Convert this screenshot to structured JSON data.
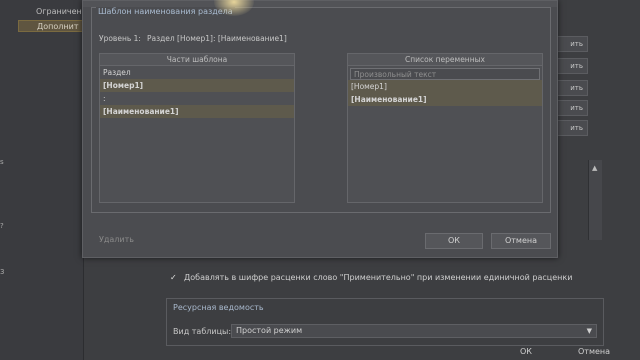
{
  "background": {
    "left_panel": {
      "items": [
        "Ограничен",
        "Дополнит"
      ],
      "selected_index": 1,
      "edge_glyphs": [
        "s",
        "?",
        "3"
      ]
    },
    "side_buttons": [
      "ить",
      "ить",
      "ить",
      "ить",
      "ить"
    ],
    "checkbox_row": {
      "checked": true,
      "label": "Добавлять в шифре расценки слово \"Применительно\" при изменении единичной расценки"
    },
    "resource_group": {
      "title": "Ресурсная ведомость",
      "view_label": "Вид таблицы:",
      "view_value": "Простой режим"
    },
    "footer": {
      "ok": "ОК",
      "cancel": "Отмена"
    }
  },
  "dialog": {
    "frame_title": "Шаблон наименования раздела",
    "level_label": "Уровень 1:",
    "level_value": "Раздел [Номер1]: [Наименование1]",
    "left_panel": {
      "header": "Части шаблона",
      "items": [
        {
          "text": "Раздел",
          "bold": false
        },
        {
          "text": "[Номер1]",
          "bold": true
        },
        {
          "text": ":",
          "bold": false
        },
        {
          "text": "[Наименование1]",
          "bold": true
        }
      ]
    },
    "right_panel": {
      "header": "Список переменных",
      "input_placeholder": "Произвольный текст",
      "items": [
        {
          "text": "[Номер1]",
          "bold": false
        },
        {
          "text": "[Наименование1]",
          "bold": true
        }
      ]
    },
    "move_left": "<<",
    "move_right": ">>",
    "delete_label": "Удалить",
    "ok_label": "ОК",
    "cancel_label": "Отмена"
  },
  "colors": {
    "accent_title": "#a9bbd0",
    "selection": "#5f5540",
    "highlight_glow": "#e6d49a"
  }
}
